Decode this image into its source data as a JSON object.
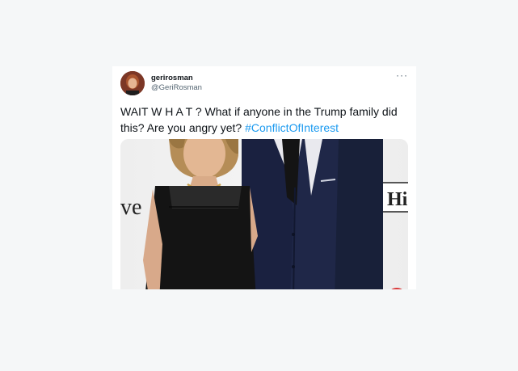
{
  "tweet": {
    "display_name": "gerirosman",
    "handle": "@GeriRosman",
    "more_menu": "···",
    "text_main": "WAIT W H A T ? What if anyone in the Trump family did this? Are you angry yet? ",
    "hashtag": "#ConflictOfInterest"
  },
  "photo": {
    "backdrop_text_left": "ve",
    "backdrop_text_right": "Hi"
  },
  "colors": {
    "hashtag": "#1d9bf0",
    "text": "#0f1419",
    "secondary": "#536471"
  }
}
